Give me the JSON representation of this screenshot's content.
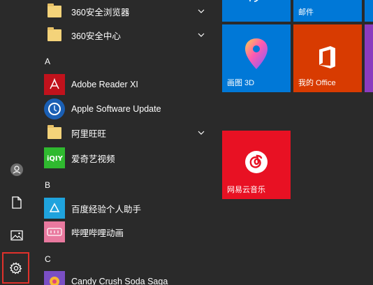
{
  "apps": {
    "item_360_browser": {
      "label": "360安全浏览器"
    },
    "item_360_center": {
      "label": "360安全中心"
    },
    "letter_a": "A",
    "item_adobe": {
      "label": "Adobe Reader XI"
    },
    "item_apple_update": {
      "label": "Apple Software Update"
    },
    "item_aliwangwang": {
      "label": "阿里旺旺"
    },
    "item_iqiyi": {
      "label": "爱奇艺视频"
    },
    "letter_b": "B",
    "item_baidu_helper": {
      "label": "百度经验个人助手"
    },
    "item_bilibili": {
      "label": "哔哩哔哩动画"
    },
    "letter_c": "C",
    "item_candy": {
      "label": "Candy Crush Soda Saga"
    }
  },
  "tiles": {
    "mail": {
      "label": "邮件",
      "color": "#0078d7"
    },
    "paint3d": {
      "label": "画图 3D",
      "color": "#0078d7"
    },
    "office": {
      "label": "我的 Office",
      "color": "#d83b01"
    },
    "netease": {
      "label": "网易云音乐",
      "color": "#e81123"
    }
  },
  "colors": {
    "accent_blue": "#0078d7",
    "office_orange": "#d83b01",
    "netease_red": "#e81123",
    "purple_partial": "#8b3bbf",
    "highlight_red": "#e0312b"
  }
}
